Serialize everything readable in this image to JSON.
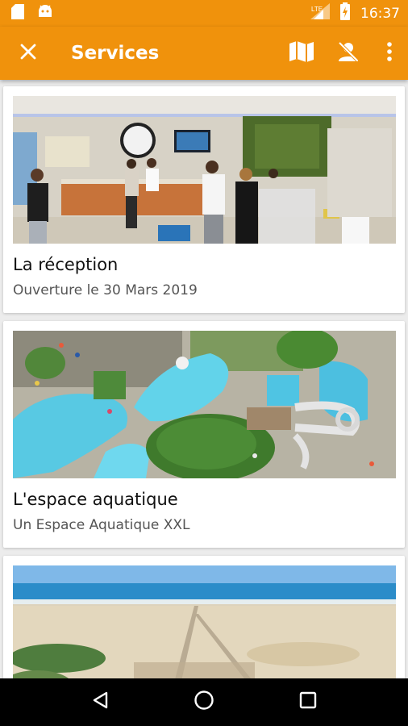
{
  "status_bar": {
    "time": "16:37",
    "network_label": "LTE",
    "icons": [
      "sd-card-icon",
      "android-icon",
      "signal-icon",
      "battery-icon"
    ]
  },
  "app_bar": {
    "title": "Services",
    "close_icon": "close-icon",
    "actions": [
      "map-icon",
      "user-off-icon",
      "more-vert-icon"
    ]
  },
  "cards": [
    {
      "title": "La réception",
      "subtitle": "Ouverture le 30 Mars 2019",
      "image": "reception-photo"
    },
    {
      "title": "L'espace aquatique",
      "subtitle": "Un Espace Aquatique XXL",
      "image": "aquatic-park-photo"
    },
    {
      "title": "",
      "subtitle": "",
      "image": "beach-photo"
    }
  ],
  "nav_bar": {
    "icons": [
      "back-icon",
      "home-icon",
      "recents-icon"
    ]
  },
  "colors": {
    "primary": "#f0920c",
    "background": "#ececec"
  }
}
